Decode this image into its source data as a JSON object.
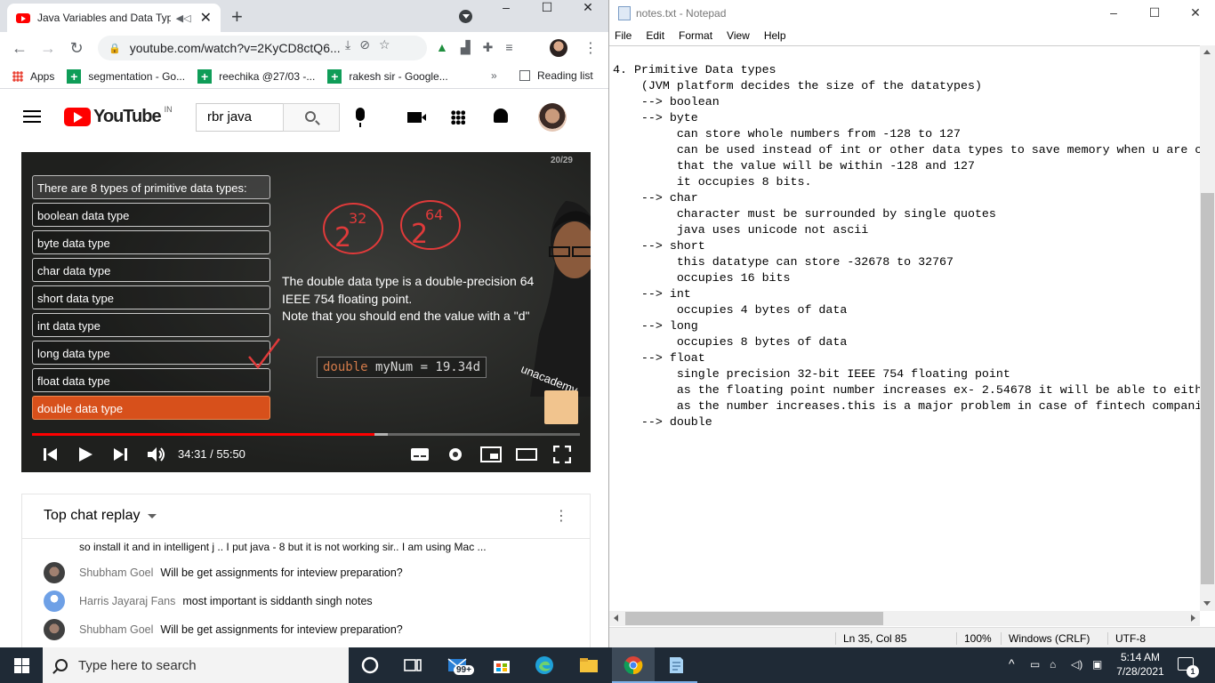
{
  "browser": {
    "tab_title": "Java Variables and Data Types in Java | Java",
    "tab_close": "✕",
    "new_tab": "+",
    "url": "youtube.com/watch?v=2KyCD8ctQ6...",
    "win_minimize": "–",
    "win_maximize": "☐",
    "win_close": "✕",
    "bookmarks": [
      {
        "label": "Apps"
      },
      {
        "label": "segmentation - Go..."
      },
      {
        "label": "reechika @27/03 -..."
      },
      {
        "label": "rakesh sir - Google..."
      }
    ],
    "bookmarks_more": "»",
    "reading_list": "Reading list"
  },
  "youtube": {
    "logo_text": "YouTube",
    "country": "IN",
    "search_value": "rbr java",
    "video": {
      "slide_number": "20/29",
      "list_header": "There are 8 types of primitive data types:",
      "types": [
        "boolean data type",
        "byte data type",
        "char data type",
        "short data type",
        "int data type",
        "long data type",
        "float data type",
        "double data type"
      ],
      "math_left_base": "2",
      "math_left_exp": "32",
      "math_right_base": "2",
      "math_right_exp": "64",
      "desc_line1": "The double data type is a double-precision 64",
      "desc_line2": "IEEE 754 floating point.",
      "desc_line3": "Note that you should end the value with a \"d\"",
      "code_keyword": "double",
      "code_rest": " myNum = 19.34d",
      "watermark": "unacademy",
      "time": "34:31 / 55:50",
      "progress_played": 0.625,
      "progress_buffered": 0.65
    },
    "chat": {
      "title": "Top chat replay",
      "continued_text": "so install it and in intelligent j .. I put java - 8 but it is not working sir.. I am using Mac ...",
      "messages": [
        {
          "author": "Shubham Goel",
          "text": "Will be get assignments for inteview preparation?"
        },
        {
          "author": "Harris Jayaraj Fans",
          "text": "most important is siddanth singh notes"
        },
        {
          "author": "Shubham Goel",
          "text": "Will be get assignments for inteview preparation?"
        }
      ]
    }
  },
  "notepad": {
    "title": "notes.txt - Notepad",
    "menu": [
      "File",
      "Edit",
      "Format",
      "View",
      "Help"
    ],
    "content": "4. Primitive Data types\n    (JVM platform decides the size of the datatypes)\n    --> boolean\n    --> byte\n         can store whole numbers from -128 to 127\n         can be used instead of int or other data types to save memory when u are ce\n         that the value will be within -128 and 127\n         it occupies 8 bits.\n    --> char\n         character must be surrounded by single quotes\n         java uses unicode not ascii\n    --> short\n         this datatype can store -32678 to 32767\n         occupies 16 bits\n    --> int\n         occupies 4 bytes of data\n    --> long\n         occupies 8 bytes of data\n    --> float\n         single precision 32-bit IEEE 754 floating point\n         as the floating point number increases ex- 2.54678 it will be able to eithe\n         as the number increases.this is a major problem in case of fintech companie\n    --> double",
    "status_position": "Ln 35, Col 85",
    "status_zoom": "100%",
    "status_eol": "Windows (CRLF)",
    "status_encoding": "UTF-8"
  },
  "taskbar": {
    "search_placeholder": "Type here to search",
    "mail_badge": "99+",
    "time": "5:14 AM",
    "date": "7/28/2021",
    "notification_count": "1"
  }
}
